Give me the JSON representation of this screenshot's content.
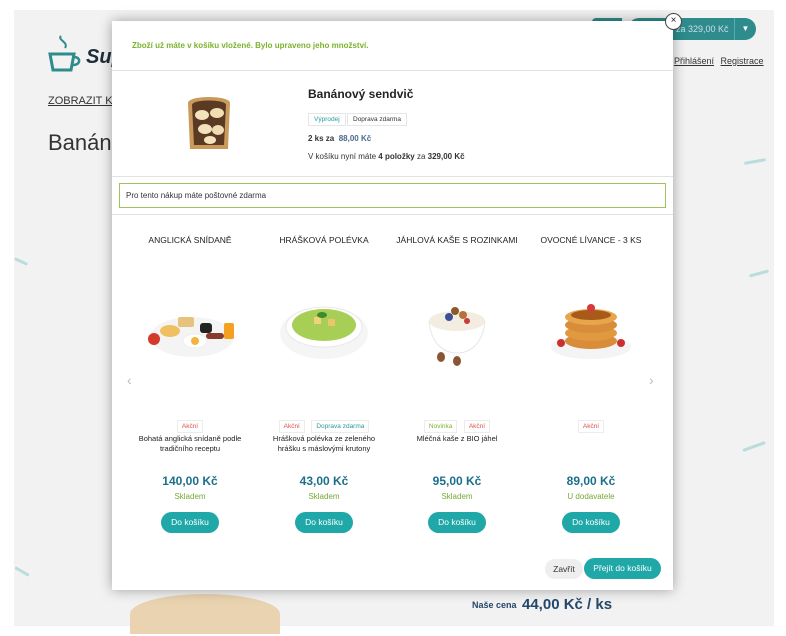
{
  "background": {
    "logo_text": "Sup",
    "cart_total": "za 329,00 Kč",
    "login_link": "Přihlášení",
    "register_link": "Registrace",
    "show_link": "ZOBRAZIT KA",
    "page_title": "Banánov",
    "price_label": "Naše cena",
    "price_value": "44,00 Kč / ks"
  },
  "modal": {
    "notice": "Zboží už máte v košíku vložené. Bylo upraveno jeho množství.",
    "close_icon": "×",
    "product": {
      "name": "Banánový sendvič",
      "tags": [
        "Výprodej",
        "Doprava zdarma"
      ],
      "qty_prefix": "2 ks za",
      "qty_price": "88,00 Kč",
      "cart_prefix": "V košíku nyní máte",
      "cart_count": "4 položky",
      "cart_mid": "za",
      "cart_total": "329,00 Kč"
    },
    "free_shipping": "Pro tento nákup máte poštovné zdarma",
    "arrow_left": "‹",
    "arrow_right": "›",
    "recommended": [
      {
        "name": "ANGLICKÁ SNÍDANĚ",
        "tags": [
          "Akční"
        ],
        "desc": "Bohatá anglická snídaně podle tradičního receptu",
        "price": "140,00 Kč",
        "stock": "Skladem",
        "button": "Do košíku"
      },
      {
        "name": "HRÁŠKOVÁ POLÉVKA",
        "tags": [
          "Akční",
          "Doprava zdarma"
        ],
        "desc": "Hrášková polévka ze zeleného hrášku s máslovými krutony",
        "price": "43,00 Kč",
        "stock": "Skladem",
        "button": "Do košíku"
      },
      {
        "name": "JÁHLOVÁ KAŠE S ROZINKAMI",
        "tags": [
          "Novinka",
          "Akční"
        ],
        "desc": "Mléčná kaše z BIO jáhel",
        "price": "95,00 Kč",
        "stock": "Skladem",
        "button": "Do košíku"
      },
      {
        "name": "OVOCNÉ LÍVANCE - 3 KS",
        "tags": [
          "Akční"
        ],
        "desc": "",
        "price": "89,00 Kč",
        "stock": "U dodavatele",
        "button": "Do košíku"
      }
    ],
    "footer": {
      "close_label": "Zavřít",
      "go_label": "Přejít do košíku"
    }
  },
  "colors": {
    "teal": "#20a7a7",
    "green": "#7ab32c",
    "price_blue": "#1b6f8a",
    "tag_red": "#d9534f",
    "tag_teal": "#2a9a9a",
    "tag_green": "#7ab32c"
  }
}
